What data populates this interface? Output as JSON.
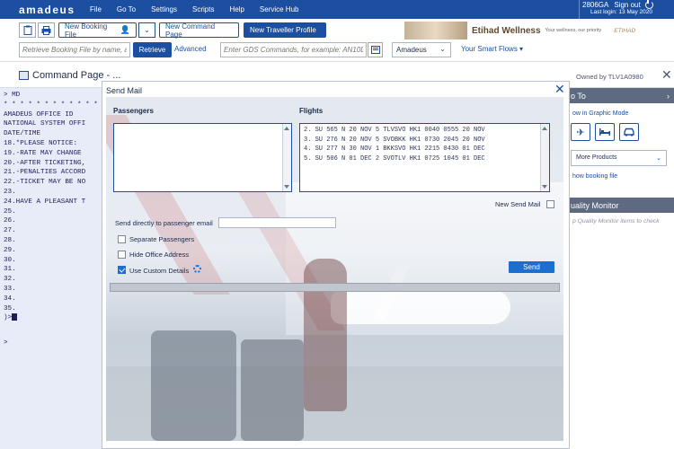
{
  "app": {
    "logo": "amadeus",
    "menu": [
      "File",
      "Go To",
      "Settings",
      "Scripts",
      "Help",
      "Service Hub"
    ],
    "office_id": "2806GA",
    "sign_out": "Sign out",
    "last_login": "Last login: 13 May 2020"
  },
  "toolbar": {
    "new_booking_file": "New Booking File",
    "new_command_page": "New Command Page",
    "new_traveller_profile": "New Traveller Profile",
    "retrieve_placeholder": "Retrieve Booking File by name, a...",
    "retrieve_button": "Retrieve",
    "advanced_link": "Advanced",
    "gds_placeholder": "Enter GDS Commands, for example: AN10D",
    "system_select": "Amadeus",
    "smart_flows": "Your Smart Flows ▾"
  },
  "ad": {
    "title": "Etihad Wellness",
    "tagline": "Your wellness, our priority",
    "brand": "ETIHAD"
  },
  "page": {
    "title": "Command Page - ...",
    "owned_by": "Owned by TLV1A0980"
  },
  "command_lines": [
    "> MD",
    "",
    "* * * * * * * * * * * * *",
    "AMADEUS OFFICE ID",
    "NATIONAL SYSTEM OFFI",
    "DATE/TIME",
    "",
    "18.*PLEASE NOTICE:",
    "19.-RATE MAY CHANGE",
    "20.-AFTER TICKETING,",
    "21.-PENALTIES ACCORD",
    "22.-TICKET MAY BE NO",
    "23.",
    "24.HAVE A PLEASANT T",
    "25.",
    "26.",
    "27.",
    "28.",
    "29.",
    "30.",
    "31.",
    "32.",
    "33.",
    "34.",
    "35.",
    ")>"
  ],
  "command_footer": ">",
  "right_panel": {
    "goto_title": "o To",
    "graphic_mode_link": "ow in Graphic Mode",
    "icons": [
      "airplane-icon",
      "hotel-bed-icon",
      "car-icon"
    ],
    "more_products": "More Products",
    "booking_file_link": "how booking file",
    "quality_title": "uality Monitor",
    "quality_note": "p Quality Monitor items to check"
  },
  "dialog": {
    "title": "Send Mail",
    "passengers_label": "Passengers",
    "flights_label": "Flights",
    "flights": [
      "2. SU 565 N 20 NOV 5 TLVSVO HK1 0040 0555 20 NOV",
      "3. SU 276 N 20 NOV 5 SVOBKK HK1 0730 2045 20 NOV",
      "4. SU 277 N 30 NOV 1 BKKSVO HK1 2215 0430 01 DEC",
      "5. SU 506 N 01 DEC 2 SVOTLV HK1 0725 1045 01 DEC"
    ],
    "new_send_mail": "New Send Mail",
    "new_send_mail_checked": false,
    "send_direct_label": "Send directly to passenger email",
    "separate_passengers": "Separate Passengers",
    "separate_passengers_checked": false,
    "hide_office_address": "Hide Office Address",
    "hide_office_address_checked": false,
    "use_custom_details": "Use Custom Details",
    "use_custom_details_checked": true,
    "send_button": "Send"
  }
}
